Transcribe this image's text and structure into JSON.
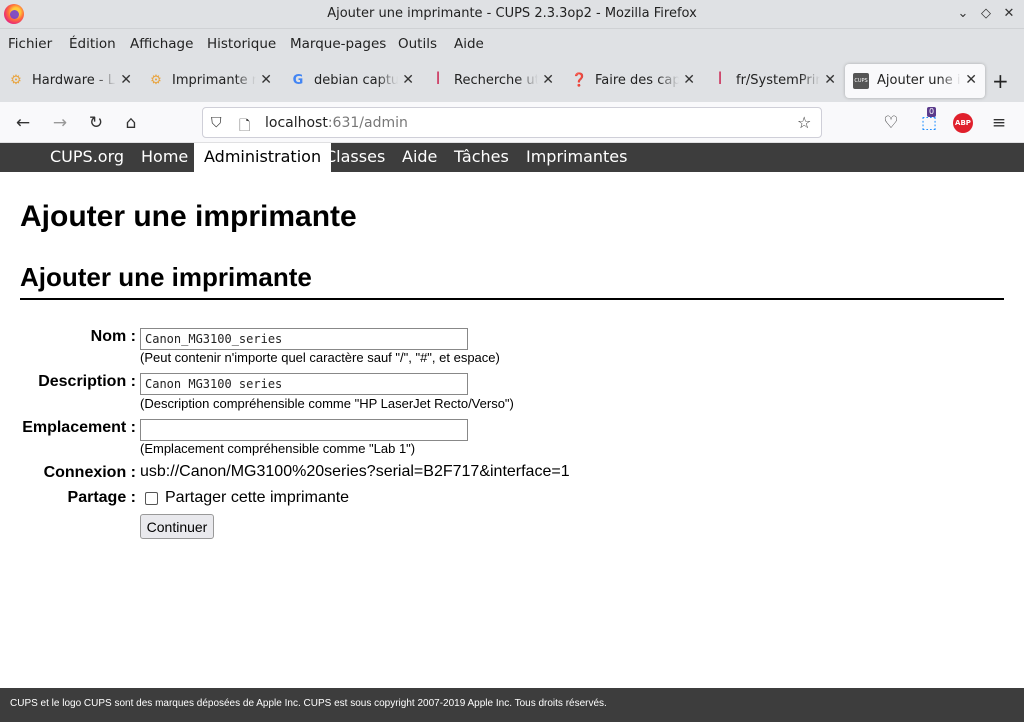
{
  "window": {
    "title": "Ajouter une imprimante - CUPS 2.3.3op2 - Mozilla Firefox"
  },
  "menu": [
    "Fichier",
    "Édition",
    "Affichage",
    "Historique",
    "Marque-pages",
    "Outils",
    "Aide"
  ],
  "tabs": [
    {
      "label": "Hardware - Li",
      "icon": "settings-icon"
    },
    {
      "label": "Imprimante n",
      "icon": "settings-icon"
    },
    {
      "label": "debian captu",
      "icon": "google-icon"
    },
    {
      "label": "Recherche ut",
      "icon": "debian-icon"
    },
    {
      "label": "Faire des cap",
      "icon": "help-icon"
    },
    {
      "label": "fr/SystemPrin",
      "icon": "debian-icon"
    },
    {
      "label": "Ajouter une i",
      "icon": "cups-icon"
    }
  ],
  "url": {
    "host": "localhost",
    "path": ":631/admin"
  },
  "badge_count": "0",
  "abp_label": "ABP",
  "cups_nav": [
    "CUPS.org",
    "Home",
    "Administration",
    "Classes",
    "Aide",
    "Tâches",
    "Imprimantes"
  ],
  "page": {
    "h1": "Ajouter une imprimante",
    "h2": "Ajouter une imprimante",
    "name_label": "Nom :",
    "name_value": "Canon_MG3100_series",
    "name_hint": "(Peut contenir n'importe quel caractère sauf \"/\", \"#\", et espace)",
    "desc_label": "Description :",
    "desc_value": "Canon MG3100 series",
    "desc_hint": "(Description compréhensible comme \"HP LaserJet Recto/Verso\")",
    "loc_label": "Emplacement :",
    "loc_value": "",
    "loc_hint": "(Emplacement compréhensible comme \"Lab 1\")",
    "conn_label": "Connexion :",
    "conn_value": "usb://Canon/MG3100%20series?serial=B2F717&interface=1",
    "share_label": "Partage :",
    "share_text": "Partager cette imprimante",
    "button": "Continuer"
  },
  "footer": {
    "a": "CUPS et le logo CUPS sont des marques déposées de ",
    "b": "Apple Inc.",
    "c": " CUPS est sous copyright 2007-2019 Apple Inc. Tous droits réservés."
  }
}
